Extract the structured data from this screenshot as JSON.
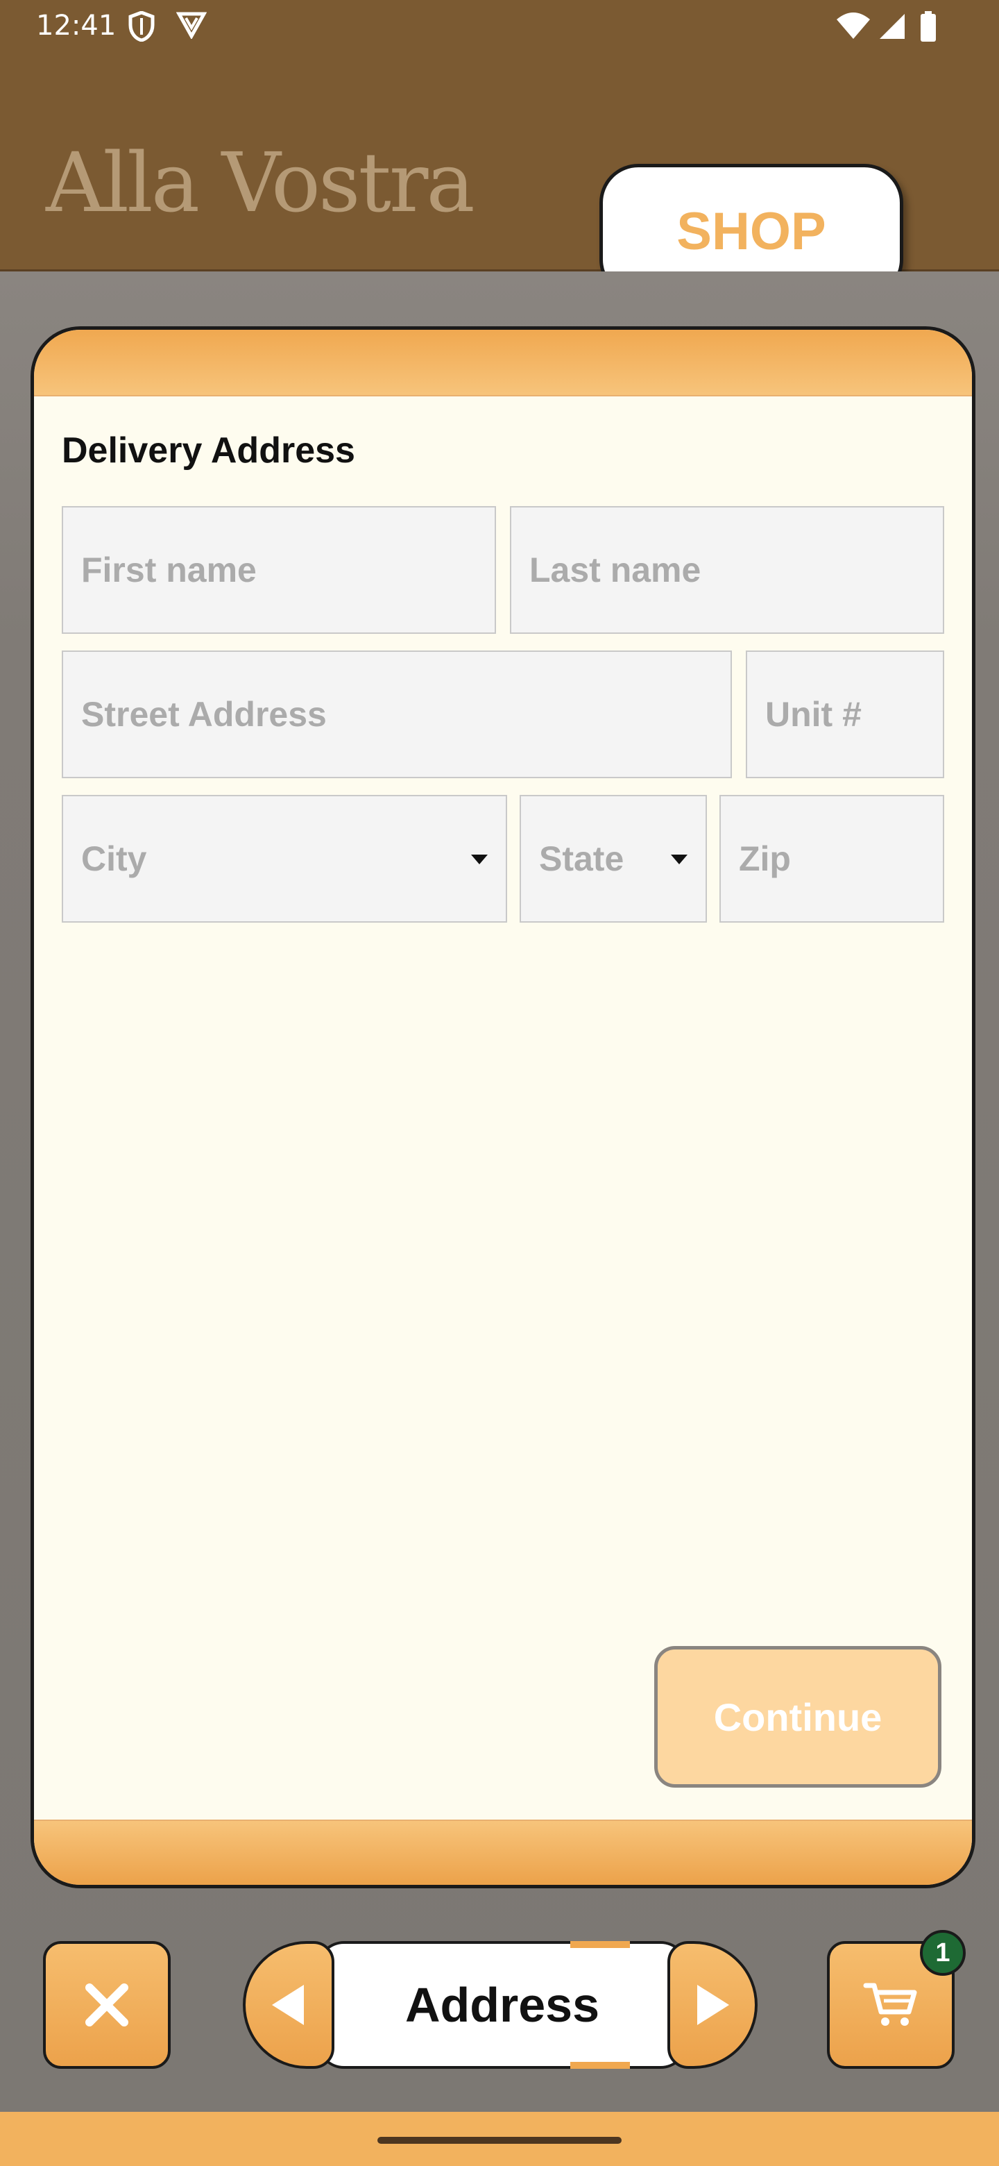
{
  "status_bar": {
    "time": "12:41"
  },
  "header": {
    "brand": "Alla Vostra",
    "shop_label": "SHOP"
  },
  "form": {
    "title": "Delivery Address",
    "first_name_placeholder": "First name",
    "last_name_placeholder": "Last name",
    "street_placeholder": "Street Address",
    "unit_placeholder": "Unit #",
    "city_placeholder": "City",
    "state_placeholder": "State",
    "zip_placeholder": "Zip",
    "continue_label": "Continue"
  },
  "bottom_bar": {
    "step_label": "Address",
    "cart_count": "1"
  },
  "colors": {
    "header_bg": "#7b5a32",
    "accent": "#f2b25e",
    "card_bg": "#fefcef",
    "badge": "#1e6a34"
  }
}
